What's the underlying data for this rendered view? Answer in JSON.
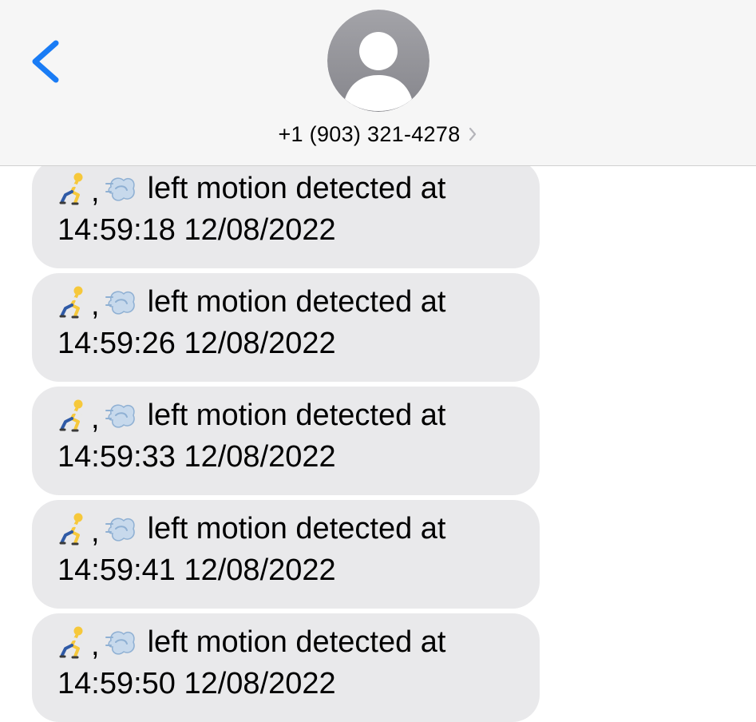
{
  "header": {
    "contact_number": "+1 (903) 321-4278"
  },
  "messages": [
    {
      "emojis": [
        "person-running-icon",
        "dash-icon"
      ],
      "separator": ",",
      "text": "left motion detected at",
      "timestamp": "14:59:18 12/08/2022"
    },
    {
      "emojis": [
        "person-running-icon",
        "dash-icon"
      ],
      "separator": ",",
      "text": "left motion detected at",
      "timestamp": "14:59:26 12/08/2022"
    },
    {
      "emojis": [
        "person-running-icon",
        "dash-icon"
      ],
      "separator": ",",
      "text": "left motion detected at",
      "timestamp": "14:59:33 12/08/2022"
    },
    {
      "emojis": [
        "person-running-icon",
        "dash-icon"
      ],
      "separator": ",",
      "text": "left motion detected at",
      "timestamp": "14:59:41 12/08/2022"
    },
    {
      "emojis": [
        "person-running-icon",
        "dash-icon"
      ],
      "separator": ",",
      "text": "left motion detected at",
      "timestamp": "14:59:50 12/08/2022"
    }
  ],
  "colors": {
    "accent": "#1a7cf5",
    "header_bg": "#f6f6f6",
    "bubble_bg": "#e9e9eb",
    "avatar_bg": "#8e8e93"
  }
}
